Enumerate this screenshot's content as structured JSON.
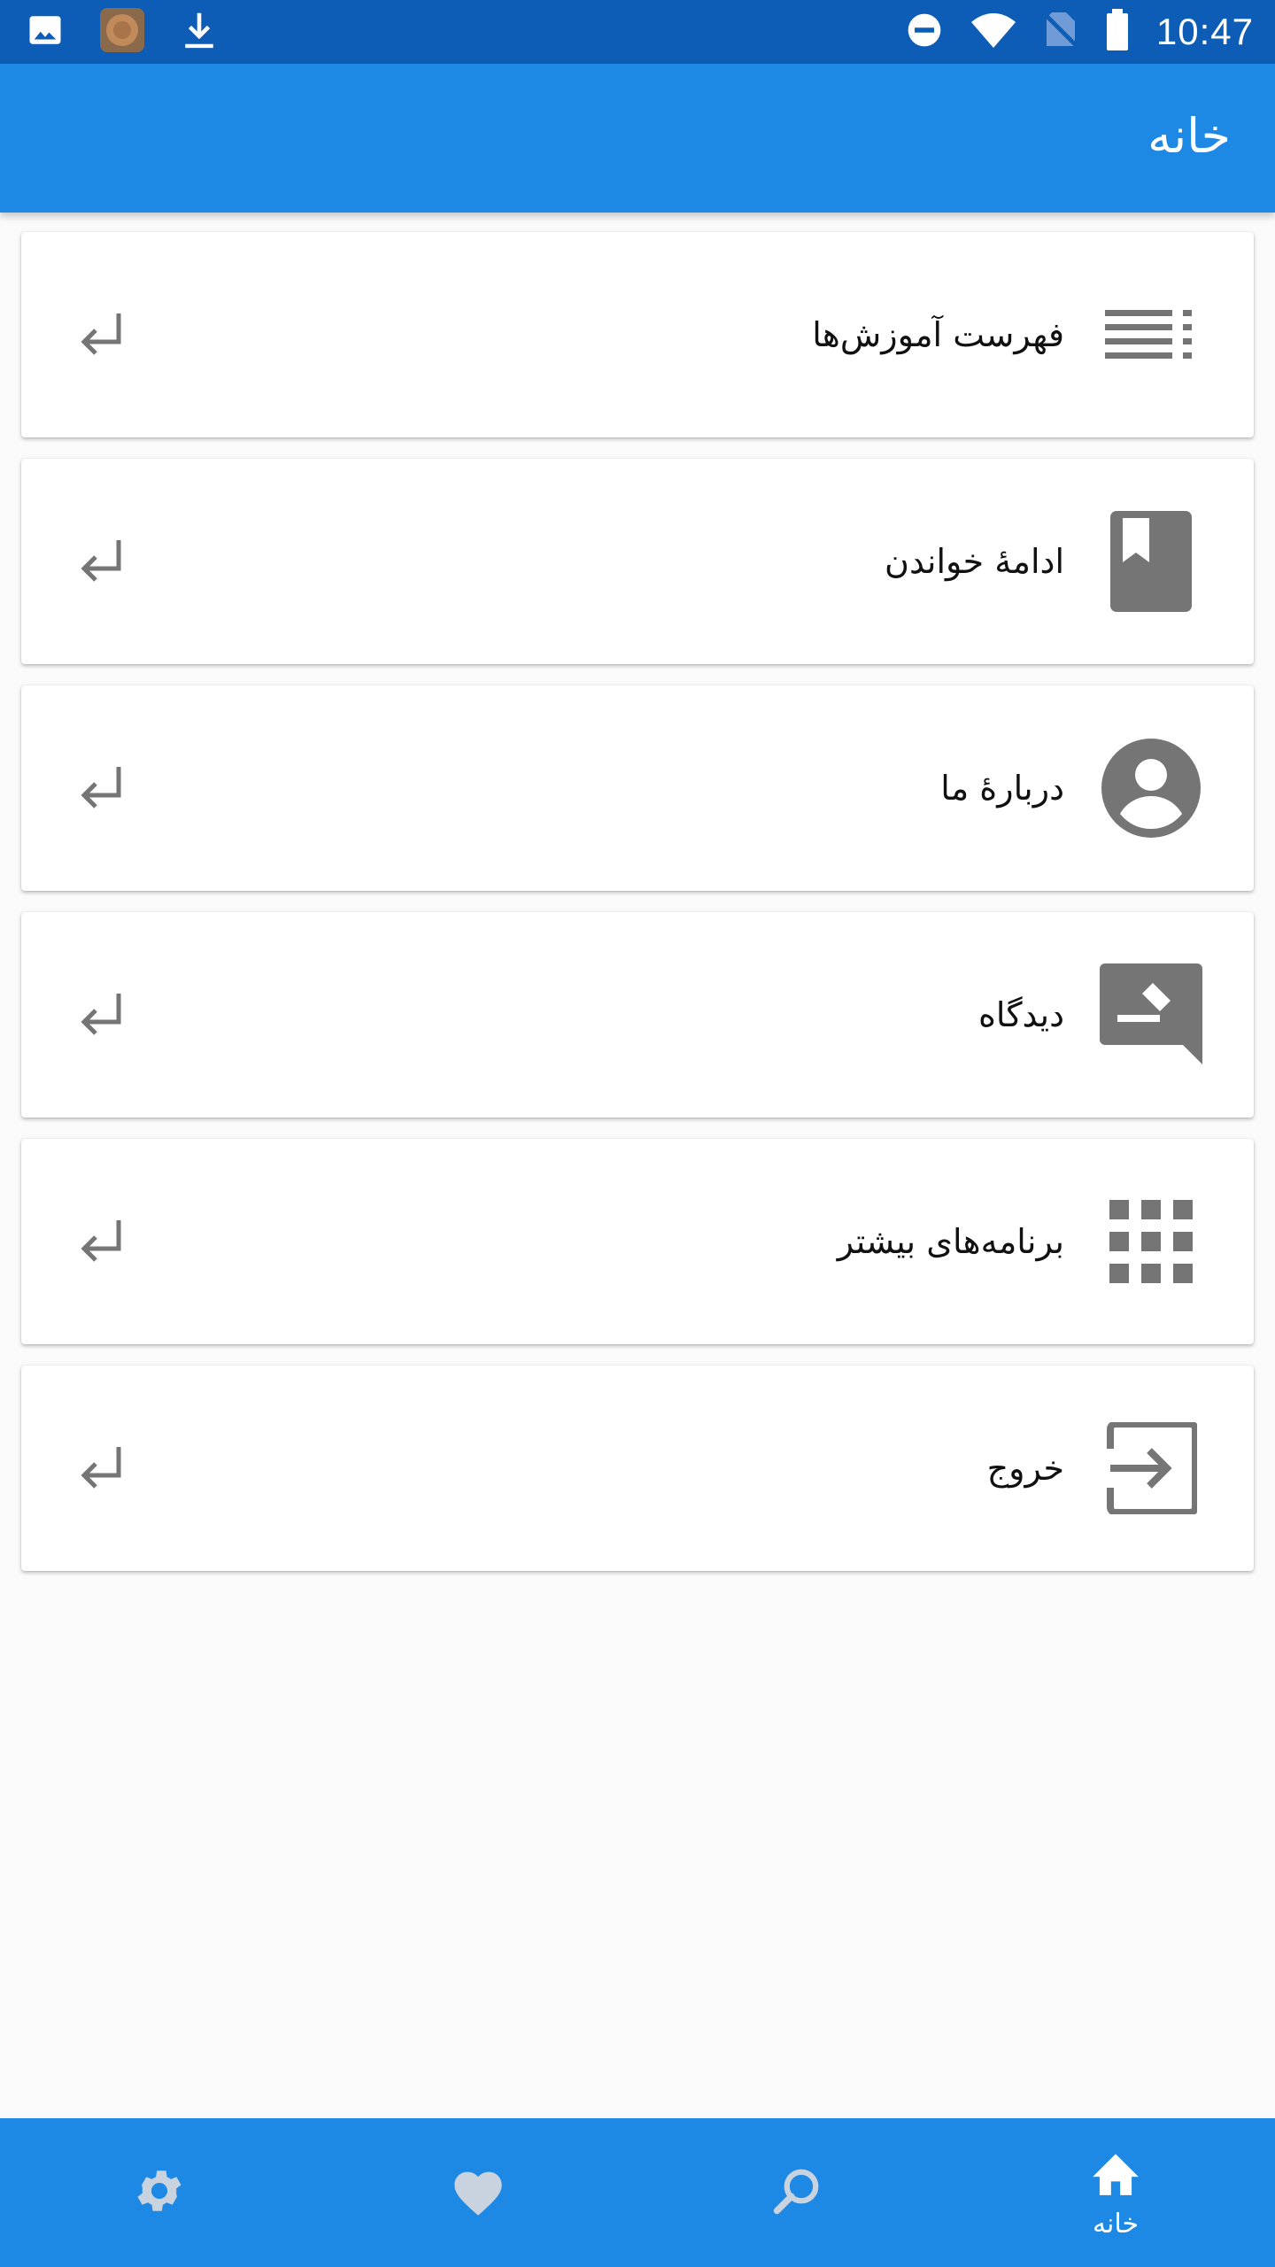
{
  "status_bar": {
    "time": "10:47",
    "left_icons": [
      "image-icon",
      "app-thumbnail-icon",
      "download-icon"
    ],
    "right_icons": [
      "do-not-disturb-icon",
      "wifi-icon",
      "no-sim-icon",
      "battery-icon"
    ]
  },
  "app_bar": {
    "title": "خانه"
  },
  "menu": {
    "items": [
      {
        "label": "فهرست آموزش‌ها",
        "icon": "list-icon"
      },
      {
        "label": "ادامهٔ خواندن",
        "icon": "bookmark-book-icon"
      },
      {
        "label": "دربارهٔ ما",
        "icon": "account-circle-icon"
      },
      {
        "label": "دیدگاه",
        "icon": "feedback-icon"
      },
      {
        "label": "برنامه‌های بیشتر",
        "icon": "apps-grid-icon"
      },
      {
        "label": "خروج",
        "icon": "exit-icon"
      }
    ],
    "item_arrow_icon": "return-arrow-icon"
  },
  "bottom_nav": {
    "items": [
      {
        "icon": "settings-icon",
        "label": ""
      },
      {
        "icon": "heart-icon",
        "label": ""
      },
      {
        "icon": "search-icon",
        "label": ""
      },
      {
        "icon": "home-icon",
        "label": "خانه"
      }
    ]
  },
  "colors": {
    "status_bar": "#0d5cb5",
    "primary": "#1e88e5",
    "icon_gray": "#757575",
    "nav_inactive": "#c9d3df",
    "background": "#fafafa"
  }
}
